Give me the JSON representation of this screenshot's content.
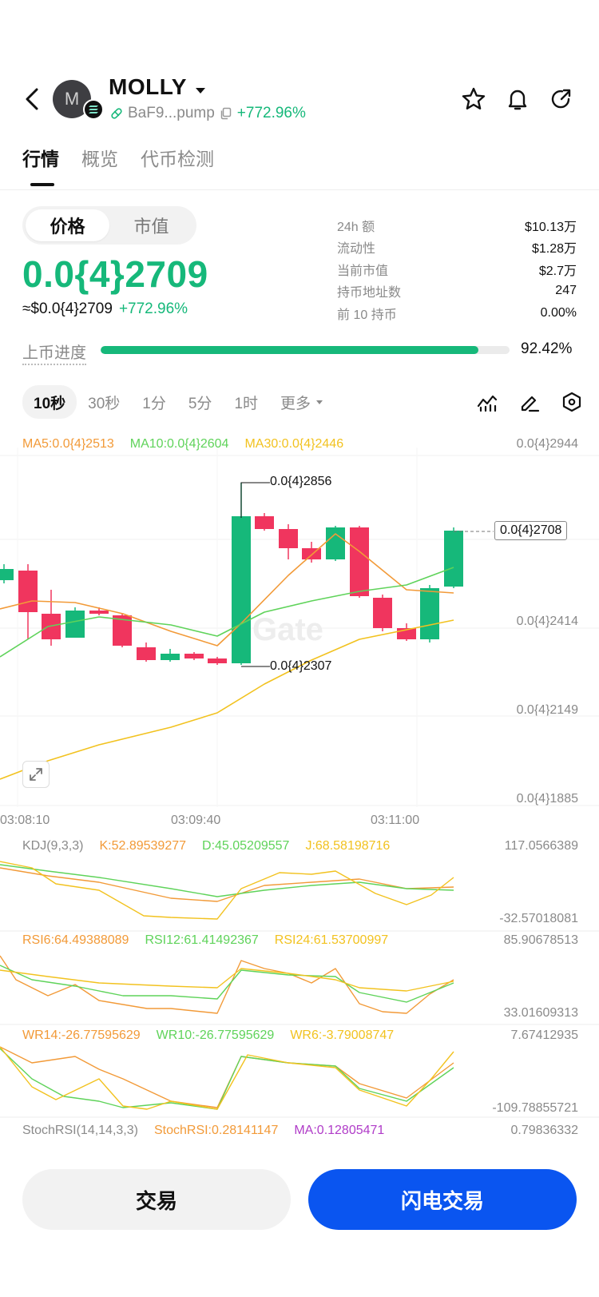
{
  "header": {
    "avatar_letter": "M",
    "token_name": "MOLLY",
    "address": "BaF9...pump",
    "change_pct": "+772.96%"
  },
  "tabs": [
    {
      "label": "行情",
      "active": true
    },
    {
      "label": "概览",
      "active": false
    },
    {
      "label": "代币检测",
      "active": false
    }
  ],
  "price_toggle": {
    "price_label": "价格",
    "mcap_label": "市值"
  },
  "price": {
    "main": "0.0{4}2709",
    "usd": "≈$0.0{4}2709",
    "change": "+772.96%"
  },
  "stats": [
    {
      "label": "24h  额",
      "value": "$10.13万"
    },
    {
      "label": "流动性",
      "value": "$1.28万"
    },
    {
      "label": "当前市值",
      "value": "$2.7万"
    },
    {
      "label": "持币地址数",
      "value": "247"
    },
    {
      "label": "前 10 持币",
      "value": "0.00%"
    }
  ],
  "progress": {
    "label": "上币进度",
    "value_text": "92.42%",
    "fraction": 0.9242
  },
  "intervals": [
    {
      "label": "10秒",
      "active": true
    },
    {
      "label": "30秒",
      "active": false
    },
    {
      "label": "1分",
      "active": false
    },
    {
      "label": "5分",
      "active": false
    },
    {
      "label": "1时",
      "active": false
    },
    {
      "label": "更多",
      "active": false
    }
  ],
  "ma_legend": {
    "ma5": "MA5:0.0{4}2513",
    "ma10": "MA10:0.0{4}2604",
    "ma30": "MA30:0.0{4}2446"
  },
  "kdj_legend": {
    "name": "KDJ(9,3,3)",
    "k": "K:52.89539277",
    "d": "D:45.05209557",
    "j": "J:68.58198716"
  },
  "rsi_legend": {
    "rsi6": "RSI6:64.49388089",
    "rsi12": "RSI12:61.41492367",
    "rsi24": "RSI24:61.53700997"
  },
  "wr_legend": {
    "wr14": "WR14:-26.77595629",
    "wr10": "WR10:-26.77595629",
    "wr6": "WR6:-3.79008747"
  },
  "stoch_legend": {
    "name": "StochRSI(14,14,3,3)",
    "stoch": "StochRSI:0.28141147",
    "ma": "MA:0.12805471"
  },
  "buttons": {
    "trade": "交易",
    "flash_trade": "闪电交易"
  },
  "colors": {
    "up": "#16b87a",
    "down": "#f0355e",
    "ma5": "#f29a38",
    "ma10": "#5fd35a",
    "ma30": "#f2c21f",
    "stoch_ma": "#b03cc8",
    "flash_button": "#0a55f0"
  },
  "chart_data": {
    "type": "candlestick",
    "price_axis": [
      "0.0{4}2944",
      "0.0{4}2414",
      "0.0{4}2149",
      "0.0{4}1885"
    ],
    "current_price_label": "0.0{4}2708",
    "high_label": "0.0{4}2856",
    "low_label": "0.0{4}2307",
    "watermark": "Gate",
    "time_labels": [
      "03:08:10",
      "03:09:40",
      "03:11:00"
    ],
    "kdj_axis": {
      "top": "117.0566389",
      "bottom": "-32.57018081"
    },
    "rsi_axis": {
      "top": "85.90678513",
      "bottom": "33.01609313"
    },
    "wr_axis": {
      "top": "7.67412935",
      "bottom": "-109.78855721"
    },
    "stoch_axis": {
      "top": "0.79836332"
    }
  }
}
